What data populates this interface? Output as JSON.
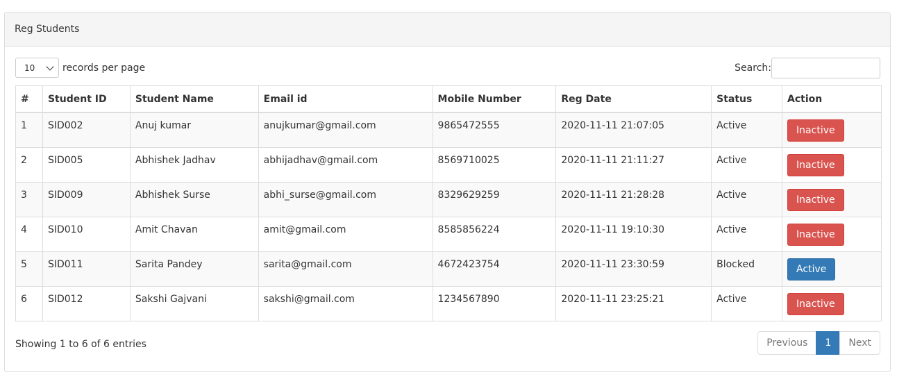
{
  "panel": {
    "title": "Reg Students"
  },
  "length_control": {
    "selected": "10",
    "label": "records per page"
  },
  "search": {
    "label": "Search:",
    "value": ""
  },
  "table": {
    "headers": [
      "#",
      "Student ID",
      "Student Name",
      "Email id",
      "Mobile Number",
      "Reg Date",
      "Status",
      "Action"
    ],
    "rows": [
      {
        "num": "1",
        "id": "SID002",
        "name": "Anuj kumar",
        "email": "anujkumar@gmail.com",
        "mobile": "9865472555",
        "date": "2020-11-11 21:07:05",
        "status": "Active",
        "action": "Inactive"
      },
      {
        "num": "2",
        "id": "SID005",
        "name": "Abhishek Jadhav",
        "email": "abhijadhav@gmail.com",
        "mobile": "8569710025",
        "date": "2020-11-11 21:11:27",
        "status": "Active",
        "action": "Inactive"
      },
      {
        "num": "3",
        "id": "SID009",
        "name": "Abhishek Surse",
        "email": "abhi_surse@gmail.com",
        "mobile": "8329629259",
        "date": "2020-11-11 21:28:28",
        "status": "Active",
        "action": "Inactive"
      },
      {
        "num": "4",
        "id": "SID010",
        "name": "Amit Chavan",
        "email": "amit@gmail.com",
        "mobile": "8585856224",
        "date": "2020-11-11 19:10:30",
        "status": "Active",
        "action": "Inactive"
      },
      {
        "num": "5",
        "id": "SID011",
        "name": "Sarita Pandey",
        "email": "sarita@gmail.com",
        "mobile": "4672423754",
        "date": "2020-11-11 23:30:59",
        "status": "Blocked",
        "action": "Active"
      },
      {
        "num": "6",
        "id": "SID012",
        "name": "Sakshi Gajvani",
        "email": "sakshi@gmail.com",
        "mobile": "1234567890",
        "date": "2020-11-11 23:25:21",
        "status": "Active",
        "action": "Inactive"
      }
    ]
  },
  "footer": {
    "info": "Showing 1 to 6 of 6 entries",
    "pagination": {
      "previous": "Previous",
      "current": "1",
      "next": "Next"
    }
  },
  "colors": {
    "danger": "#d9534f",
    "primary": "#337ab7",
    "heading_bg": "#f5f5f5",
    "stripe": "#f9f9f9"
  }
}
